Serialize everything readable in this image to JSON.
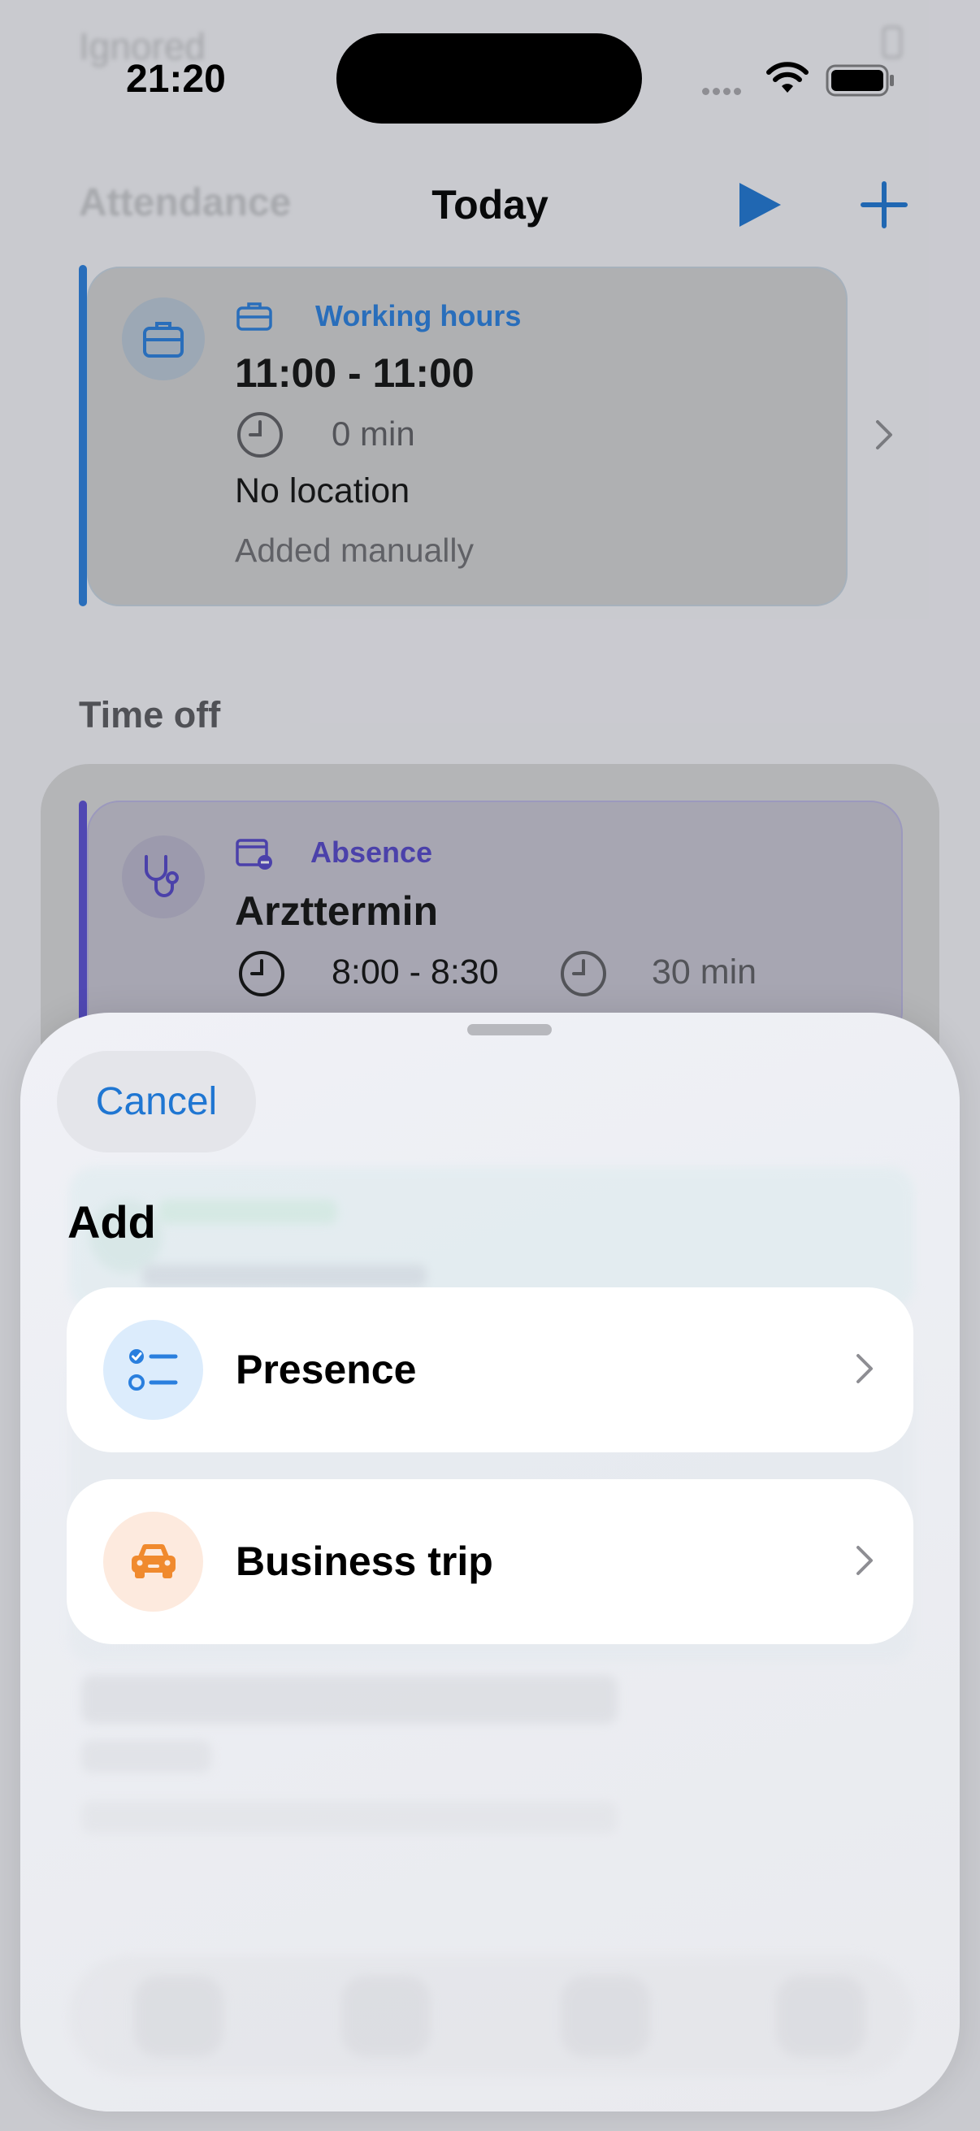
{
  "status_bar": {
    "time": "21:20"
  },
  "background": {
    "ghost_top_text": "Ignored",
    "nav_ghost_text": "Attendance",
    "nav_title": "Today",
    "working_entry": {
      "type_label": "Working hours",
      "time_range": "11:00 - 11:00",
      "duration": "0 min",
      "location": "No location",
      "note": "Added manually",
      "accent_color": "#2a7fde"
    },
    "time_off_section_title": "Time off",
    "absence_entry": {
      "type_label": "Absence",
      "title": "Arzttermin",
      "time_range": "8:00 - 8:30",
      "duration": "30 min",
      "accent_color": "#5b4fd4"
    }
  },
  "sheet": {
    "cancel_label": "Cancel",
    "title": "Add",
    "options": [
      {
        "label": "Presence",
        "icon": "checklist-icon",
        "color": "#2a7fde"
      },
      {
        "label": "Business trip",
        "icon": "car-icon",
        "color": "#f08a2e"
      }
    ]
  }
}
